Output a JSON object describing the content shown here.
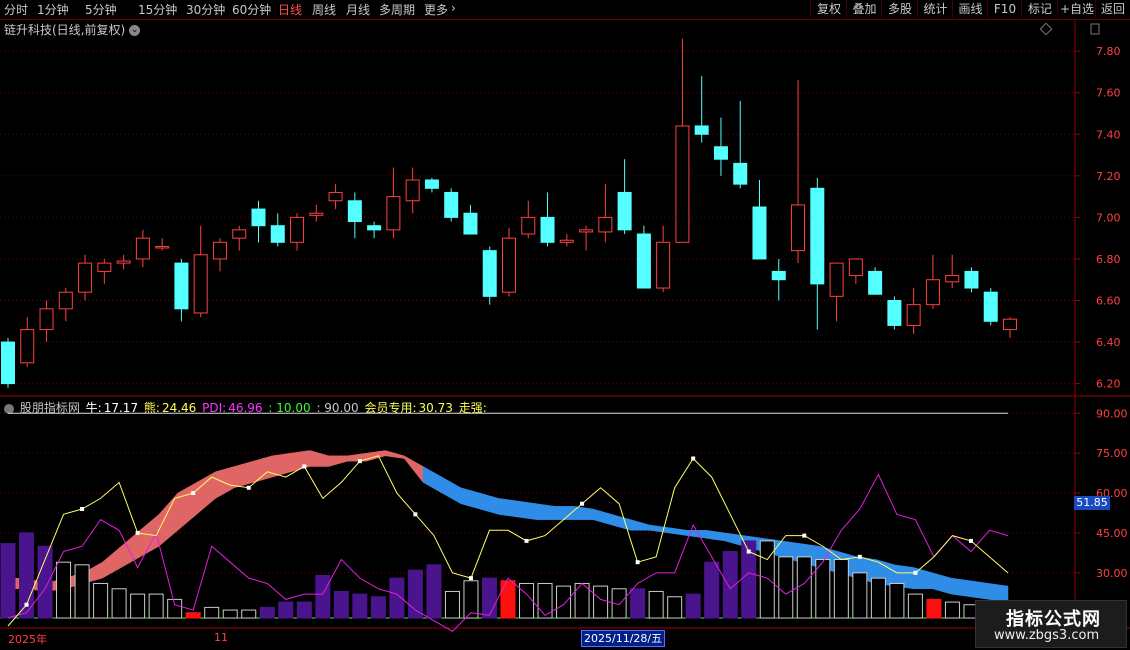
{
  "toolbar": {
    "tabs": [
      {
        "label": "分时",
        "x": 4
      },
      {
        "label": "1分钟",
        "x": 37
      },
      {
        "label": "5分钟",
        "x": 85
      },
      {
        "label": "15分钟",
        "x": 138
      },
      {
        "label": "30分钟",
        "x": 186
      },
      {
        "label": "60分钟",
        "x": 232
      },
      {
        "label": "日线",
        "x": 278,
        "active": true
      },
      {
        "label": "周线",
        "x": 312
      },
      {
        "label": "月线",
        "x": 346
      },
      {
        "label": "多周期",
        "x": 379
      },
      {
        "label": "更多",
        "x": 424
      }
    ],
    "more_arrow": "›",
    "right_buttons": [
      "复权",
      "叠加",
      "多股",
      "统计",
      "画线",
      "F10",
      "标记",
      "+自选",
      "返回"
    ]
  },
  "stock_title": "链升科技(日线,前复权)",
  "price_axis": [
    "7.80",
    "7.60",
    "7.40",
    "7.20",
    "7.00",
    "6.80",
    "6.60",
    "6.40",
    "6.20"
  ],
  "indicator": {
    "name": "股朋指标网",
    "niu_label": "牛:",
    "niu": "17.17",
    "xiong_label": "熊:",
    "xiong": "24.46",
    "pdi_label": "PDI:",
    "pdi": "46.96",
    "v10": ": 10.00",
    "v90": ": 90.00",
    "member_label": "会员专用:",
    "member": "30.73",
    "strong_label": "走强:",
    "axis": [
      "90.00",
      "75.00",
      "60.00",
      "45.00",
      "30.00",
      "15.00"
    ],
    "current_value": "51.85"
  },
  "date_axis": {
    "year": "2025年",
    "month": "11",
    "cursor": "2025/11/28/五"
  },
  "watermark": {
    "title": "指标公式网",
    "url": "www.zbgs3.com"
  },
  "chart_data": {
    "type": "candlestick",
    "title": "链升科技(日线,前复权)",
    "ylim": [
      6.15,
      7.95
    ],
    "ohlc": [
      [
        6.4,
        6.42,
        6.18,
        6.2
      ],
      [
        6.3,
        6.52,
        6.28,
        6.46
      ],
      [
        6.46,
        6.6,
        6.4,
        6.56
      ],
      [
        6.56,
        6.66,
        6.5,
        6.64
      ],
      [
        6.64,
        6.82,
        6.6,
        6.78
      ],
      [
        6.74,
        6.8,
        6.68,
        6.78
      ],
      [
        6.78,
        6.82,
        6.75,
        6.79
      ],
      [
        6.8,
        6.94,
        6.76,
        6.9
      ],
      [
        6.86,
        6.9,
        6.84,
        6.86
      ],
      [
        6.78,
        6.8,
        6.5,
        6.56
      ],
      [
        6.54,
        6.96,
        6.52,
        6.82
      ],
      [
        6.8,
        6.9,
        6.74,
        6.88
      ],
      [
        6.9,
        6.96,
        6.84,
        6.94
      ],
      [
        7.04,
        7.08,
        6.88,
        6.96
      ],
      [
        6.96,
        7.02,
        6.86,
        6.88
      ],
      [
        6.88,
        7.02,
        6.84,
        7.0
      ],
      [
        7.01,
        7.06,
        6.98,
        7.02
      ],
      [
        7.08,
        7.16,
        7.04,
        7.12
      ],
      [
        7.08,
        7.12,
        6.9,
        6.98
      ],
      [
        6.96,
        6.98,
        6.9,
        6.94
      ],
      [
        6.94,
        7.24,
        6.9,
        7.1
      ],
      [
        7.08,
        7.24,
        7.02,
        7.18
      ],
      [
        7.18,
        7.19,
        7.12,
        7.14
      ],
      [
        7.12,
        7.14,
        6.98,
        7.0
      ],
      [
        7.02,
        7.06,
        6.94,
        6.92
      ],
      [
        6.84,
        6.86,
        6.58,
        6.62
      ],
      [
        6.64,
        6.95,
        6.62,
        6.9
      ],
      [
        6.92,
        7.08,
        6.9,
        7.0
      ],
      [
        7.0,
        7.12,
        6.86,
        6.88
      ],
      [
        6.88,
        6.92,
        6.86,
        6.89
      ],
      [
        6.93,
        6.96,
        6.84,
        6.94
      ],
      [
        6.93,
        7.16,
        6.88,
        7.0
      ],
      [
        7.12,
        7.28,
        6.92,
        6.94
      ],
      [
        6.92,
        6.96,
        6.66,
        6.66
      ],
      [
        6.66,
        6.96,
        6.64,
        6.88
      ],
      [
        6.88,
        7.86,
        6.88,
        7.44
      ],
      [
        7.44,
        7.68,
        7.36,
        7.4
      ],
      [
        7.34,
        7.48,
        7.2,
        7.28
      ],
      [
        7.26,
        7.56,
        7.14,
        7.16
      ],
      [
        7.05,
        7.18,
        6.8,
        6.8
      ],
      [
        6.74,
        6.8,
        6.6,
        6.7
      ],
      [
        6.84,
        7.66,
        6.78,
        7.06
      ],
      [
        7.14,
        7.19,
        6.46,
        6.68
      ],
      [
        6.62,
        6.78,
        6.5,
        6.78
      ],
      [
        6.72,
        6.8,
        6.68,
        6.8
      ],
      [
        6.74,
        6.76,
        6.63,
        6.63
      ],
      [
        6.6,
        6.62,
        6.46,
        6.48
      ],
      [
        6.48,
        6.66,
        6.44,
        6.58
      ],
      [
        6.58,
        6.82,
        6.56,
        6.7
      ],
      [
        6.69,
        6.82,
        6.66,
        6.72
      ],
      [
        6.74,
        6.76,
        6.64,
        6.66
      ],
      [
        6.64,
        6.66,
        6.48,
        6.5
      ],
      [
        6.46,
        6.52,
        6.42,
        6.51
      ]
    ],
    "indicator": {
      "ylim": [
        10,
        95
      ],
      "yellow": [
        10,
        18,
        35,
        52,
        54,
        58,
        64,
        45,
        44,
        58,
        60,
        66,
        63,
        62,
        68,
        66,
        70,
        58,
        64,
        72,
        74,
        60,
        52,
        44,
        30,
        28,
        46,
        46,
        42,
        44,
        50,
        56,
        62,
        56,
        34,
        36,
        62,
        73,
        66,
        52,
        38,
        35,
        44,
        44,
        40,
        35,
        36,
        34,
        30,
        30,
        36,
        44,
        42,
        36,
        30
      ],
      "magenta": [
        13,
        15,
        24,
        38,
        40,
        50,
        46,
        32,
        45,
        18,
        16,
        40,
        34,
        28,
        26,
        20,
        22,
        22,
        35,
        28,
        24,
        22,
        16,
        12,
        8,
        15,
        14,
        28,
        22,
        14,
        18,
        26,
        20,
        18,
        26,
        30,
        30,
        48,
        36,
        24,
        30,
        28,
        22,
        26,
        34,
        46,
        54,
        67,
        52,
        50,
        36,
        44,
        38,
        46,
        44
      ],
      "band_top": [
        28,
        28,
        26,
        28,
        30,
        34,
        40,
        46,
        52,
        60,
        64,
        68,
        70,
        72,
        74,
        75,
        76,
        74,
        74,
        75,
        76,
        74,
        70,
        66,
        62,
        60,
        58,
        57,
        56,
        55,
        55,
        54,
        52,
        50,
        48,
        47,
        46,
        46,
        45,
        44,
        43,
        42,
        41,
        40,
        38,
        36,
        35,
        33,
        32,
        30,
        28,
        27,
        26,
        25
      ],
      "band_bottom": [
        24,
        24,
        23,
        24,
        26,
        28,
        32,
        36,
        40,
        46,
        52,
        58,
        62,
        64,
        66,
        68,
        70,
        70,
        72,
        72,
        74,
        73,
        64,
        60,
        56,
        54,
        52,
        51,
        50,
        50,
        50,
        50,
        48,
        46,
        46,
        45,
        44,
        43,
        42,
        40,
        38,
        36,
        34,
        32,
        30,
        28,
        26,
        25,
        24,
        24,
        22,
        21,
        20,
        19
      ],
      "bars": [
        41,
        45,
        40,
        34,
        33,
        26,
        24,
        22,
        22,
        20,
        15,
        17,
        16,
        16,
        17,
        19,
        19,
        29,
        23,
        22,
        21,
        28,
        31,
        33,
        23,
        27,
        28,
        27,
        26,
        26,
        25,
        26,
        25,
        24,
        24,
        23,
        21,
        22,
        34,
        38,
        42,
        42,
        36,
        36,
        35,
        35,
        30,
        28,
        26,
        22,
        20,
        19,
        18,
        17,
        17
      ],
      "bar_colors": [
        "p",
        "p",
        "p",
        "w",
        "w",
        "w",
        "w",
        "w",
        "w",
        "w",
        "r",
        "w",
        "w",
        "w",
        "p",
        "p",
        "p",
        "p",
        "p",
        "p",
        "p",
        "p",
        "p",
        "p",
        "w",
        "w",
        "p",
        "r",
        "w",
        "w",
        "w",
        "w",
        "w",
        "w",
        "p",
        "w",
        "w",
        "p",
        "p",
        "p",
        "p",
        "w",
        "w",
        "w",
        "w",
        "w",
        "w",
        "w",
        "w",
        "w",
        "r",
        "w",
        "w",
        "w",
        "w"
      ]
    }
  }
}
